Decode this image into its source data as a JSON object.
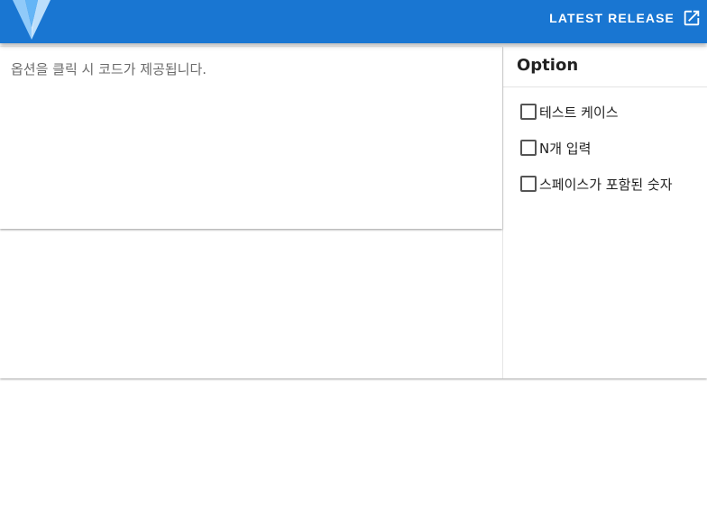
{
  "app_bar": {
    "logo_icon": "vuetify-logo-icon",
    "release_label": "LATEST RELEASE",
    "release_icon": "open-in-new-icon",
    "background_color": "#1976d2"
  },
  "code_panel": {
    "placeholder": "옵션을 클릭 시 코드가 제공됩니다."
  },
  "options": {
    "title": "Option",
    "items": [
      {
        "label": "테스트 케이스",
        "checked": false
      },
      {
        "label": "N개 입력",
        "checked": false
      },
      {
        "label": "스페이스가 포함된 숫자",
        "checked": false
      }
    ]
  }
}
